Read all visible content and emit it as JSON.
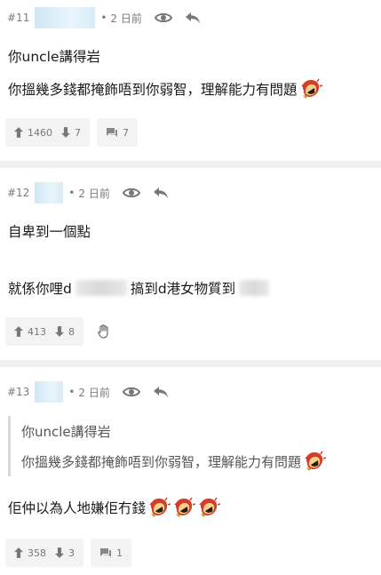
{
  "posts": [
    {
      "floor": "#11",
      "time": "2 日前",
      "lines": [
        "你uncle講得岩",
        "你搵幾多錢都掩飾唔到你弱智，理解能力有問題"
      ],
      "likes": "1460",
      "dislikes": "7",
      "replies": "7"
    },
    {
      "floor": "#12",
      "time": "2 日前",
      "line1": "自卑到一個點",
      "line2_a": "就係你哩d",
      "line2_b": "搞到d港女物質到",
      "likes": "413",
      "dislikes": "8"
    },
    {
      "floor": "#13",
      "time": "2 日前",
      "quote": [
        "你uncle講得岩",
        "你搵幾多錢都掩飾唔到你弱智，理解能力有問題"
      ],
      "line": "佢仲以為人地嫌佢冇錢",
      "likes": "358",
      "dislikes": "3",
      "replies": "1"
    }
  ],
  "icons": {
    "eye": "eye-icon",
    "reply": "reply-arrow-icon",
    "up": "thumb-up-arrow-icon",
    "down": "thumb-down-arrow-icon",
    "comment": "comment-bubble-icon",
    "hand": "wave-hand-icon"
  },
  "colors": {
    "meta_grey": "#7a7a7a",
    "button_bg": "#f3f3f3",
    "separator": "#f0f0f0"
  }
}
